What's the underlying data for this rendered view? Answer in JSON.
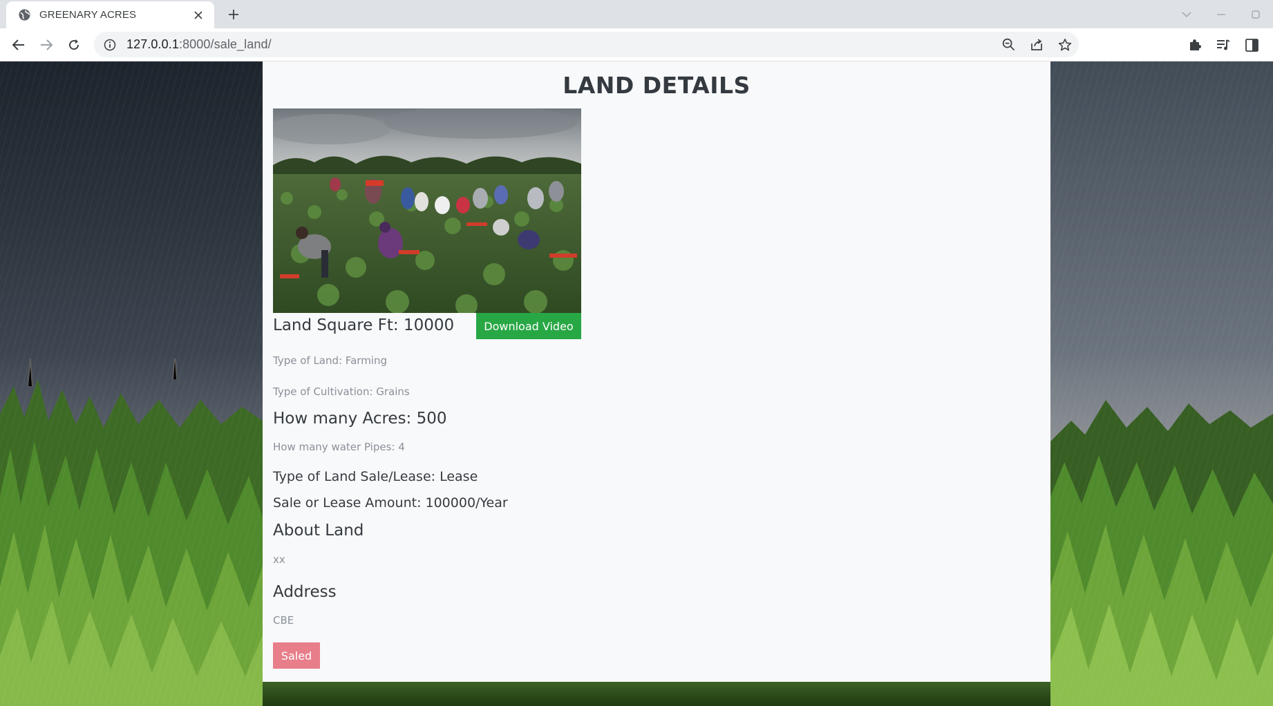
{
  "browser": {
    "tab_title": "GREENARY ACRES",
    "url_host": "127.0.0.1",
    "url_rest": ":8000/sale_land/"
  },
  "page": {
    "title": "LAND DETAILS",
    "image_alt": "Workers harvesting in a green field",
    "land_sqft": "Land Square Ft: 10000",
    "download_label": "Download Video",
    "type_of_land": "Type of Land: Farming",
    "type_of_cultivation": "Type of Cultivation: Grains",
    "acres": "How many Acres: 500",
    "water_pipes": "How many water Pipes: 4",
    "sale_lease_type": "Type of Land Sale/Lease: Lease",
    "amount": "Sale or Lease Amount: 100000/Year",
    "about_heading": "About Land",
    "about_text": "xx",
    "address_heading": "Address",
    "address_text": "CBE",
    "status_label": "Saled"
  },
  "colors": {
    "download_button": "#28a745",
    "status_button": "#e77e8a",
    "panel_bg": "#f8f9fa"
  },
  "icons": [
    "globe-icon",
    "close-icon",
    "plus-icon",
    "back-icon",
    "forward-icon",
    "reload-icon",
    "info-icon",
    "zoom-out-icon",
    "share-icon",
    "star-icon",
    "extensions-icon",
    "reading-list-icon",
    "side-panel-icon",
    "chevron-down-icon",
    "minimize-icon"
  ]
}
